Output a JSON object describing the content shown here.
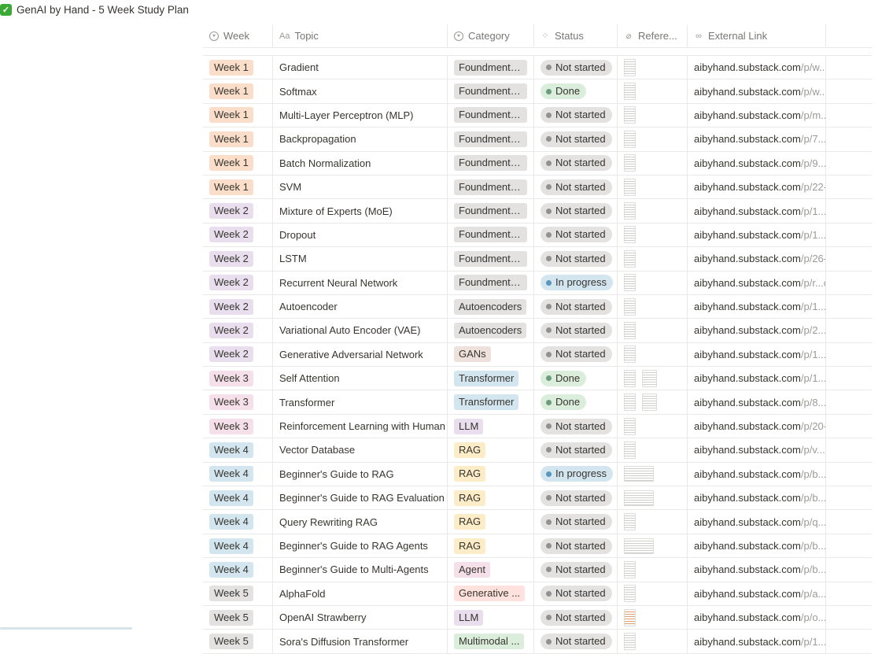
{
  "window": {
    "title": "GenAI by Hand - 5 Week Study Plan"
  },
  "headers": {
    "week": "Week",
    "topic": "Topic",
    "category": "Category",
    "status": "Status",
    "reference": "Refere...",
    "link": "External Link",
    "topic_icon": "Aa"
  },
  "rows": [
    {
      "week": "Week 1",
      "wk": "w1",
      "topic": "Gradient",
      "category": "Foundmentals",
      "cat": "cat-f",
      "status": "Not started",
      "st": "st-ns",
      "link_domain": "aibyhand.substack.com",
      "link_path": "/p/w..."
    },
    {
      "week": "Week 1",
      "wk": "w1",
      "topic": "Softmax",
      "category": "Foundmentals",
      "cat": "cat-f",
      "status": "Done",
      "st": "st-done",
      "link_domain": "aibyhand.substack.com",
      "link_path": "/p/w..."
    },
    {
      "week": "Week 1",
      "wk": "w1",
      "topic": "Multi-Layer Perceptron (MLP)",
      "category": "Foundmentals",
      "cat": "cat-f",
      "status": "Not started",
      "st": "st-ns",
      "link_domain": "aibyhand.substack.com",
      "link_path": "/p/m..."
    },
    {
      "week": "Week 1",
      "wk": "w1",
      "topic": "Backpropagation",
      "category": "Foundmentals",
      "cat": "cat-f",
      "status": "Not started",
      "st": "st-ns",
      "link_domain": "aibyhand.substack.com",
      "link_path": "/p/7..."
    },
    {
      "week": "Week 1",
      "wk": "w1",
      "topic": "Batch Normalization",
      "category": "Foundmentals",
      "cat": "cat-f",
      "status": "Not started",
      "st": "st-ns",
      "link_domain": "aibyhand.substack.com",
      "link_path": "/p/9..."
    },
    {
      "week": "Week 1",
      "wk": "w1",
      "topic": "SVM",
      "category": "Foundmentals",
      "cat": "cat-f",
      "status": "Not started",
      "st": "st-ns",
      "link_domain": "aibyhand.substack.com",
      "link_path": "/p/22-"
    },
    {
      "week": "Week 2",
      "wk": "w2",
      "topic": "Mixture of Experts (MoE)",
      "category": "Foundmentals",
      "cat": "cat-f",
      "status": "Not started",
      "st": "st-ns",
      "link_domain": "aibyhand.substack.com",
      "link_path": "/p/1..."
    },
    {
      "week": "Week 2",
      "wk": "w2",
      "topic": "Dropout",
      "category": "Foundmentals",
      "cat": "cat-f",
      "status": "Not started",
      "st": "st-ns",
      "link_domain": "aibyhand.substack.com",
      "link_path": "/p/1..."
    },
    {
      "week": "Week 2",
      "wk": "w2",
      "topic": "LSTM",
      "category": "Foundmentals",
      "cat": "cat-f",
      "status": "Not started",
      "st": "st-ns",
      "link_domain": "aibyhand.substack.com",
      "link_path": "/p/26-"
    },
    {
      "week": "Week 2",
      "wk": "w2",
      "topic": "Recurrent Neural Network",
      "category": "Foundmentals",
      "cat": "cat-f",
      "status": "In progress",
      "st": "st-ip",
      "link_domain": "aibyhand.substack.com",
      "link_path": "/p/r...c"
    },
    {
      "week": "Week 2",
      "wk": "w2",
      "topic": "Autoencoder",
      "category": "Autoencoders",
      "cat": "cat-a",
      "status": "Not started",
      "st": "st-ns",
      "link_domain": "aibyhand.substack.com",
      "link_path": "/p/1..."
    },
    {
      "week": "Week 2",
      "wk": "w2",
      "topic": "Variational Auto Encoder (VAE)",
      "category": "Autoencoders",
      "cat": "cat-a",
      "status": "Not started",
      "st": "st-ns",
      "link_domain": "aibyhand.substack.com",
      "link_path": "/p/2..."
    },
    {
      "week": "Week 2",
      "wk": "w2",
      "topic": "Generative Adversarial Network",
      "category": "GANs",
      "cat": "cat-g",
      "status": "Not started",
      "st": "st-ns",
      "link_domain": "aibyhand.substack.com",
      "link_path": "/p/1..."
    },
    {
      "week": "Week 3",
      "wk": "w3",
      "topic": "Self Attention",
      "category": "Transformer",
      "cat": "cat-t",
      "status": "Done",
      "st": "st-done",
      "link_domain": "aibyhand.substack.com",
      "link_path": "/p/1...",
      "two": true
    },
    {
      "week": "Week 3",
      "wk": "w3",
      "topic": "Transformer",
      "category": "Transformer",
      "cat": "cat-t",
      "status": "Done",
      "st": "st-done",
      "link_domain": "aibyhand.substack.com",
      "link_path": "/p/8...",
      "two": true
    },
    {
      "week": "Week 3",
      "wk": "w3",
      "topic": "Reinforcement Learning with Human",
      "category": "LLM",
      "cat": "cat-l",
      "status": "Not started",
      "st": "st-ns",
      "link_domain": "aibyhand.substack.com",
      "link_path": "/p/20-"
    },
    {
      "week": "Week 4",
      "wk": "w4",
      "topic": "Vector Database",
      "category": "RAG",
      "cat": "cat-r",
      "status": "Not started",
      "st": "st-ns",
      "link_domain": "aibyhand.substack.com",
      "link_path": "/p/v...c"
    },
    {
      "week": "Week 4",
      "wk": "w4",
      "topic": "Beginner's Guide to RAG",
      "category": "RAG",
      "cat": "cat-r",
      "status": "In progress",
      "st": "st-ip",
      "link_domain": "aibyhand.substack.com",
      "link_path": "/p/b...",
      "wide": true
    },
    {
      "week": "Week 4",
      "wk": "w4",
      "topic": "Beginner's Guide to RAG Evaluation",
      "category": "RAG",
      "cat": "cat-r",
      "status": "Not started",
      "st": "st-ns",
      "link_domain": "aibyhand.substack.com",
      "link_path": "/p/b...",
      "wide": true
    },
    {
      "week": "Week 4",
      "wk": "w4",
      "topic": "Query Rewriting RAG",
      "category": "RAG",
      "cat": "cat-r",
      "status": "Not started",
      "st": "st-ns",
      "link_domain": "aibyhand.substack.com",
      "link_path": "/p/q..."
    },
    {
      "week": "Week 4",
      "wk": "w4",
      "topic": "Beginner's Guide to RAG Agents",
      "category": "RAG",
      "cat": "cat-r",
      "status": "Not started",
      "st": "st-ns",
      "link_domain": "aibyhand.substack.com",
      "link_path": "/p/b...",
      "wide": true
    },
    {
      "week": "Week 4",
      "wk": "w4",
      "topic": "Beginner's Guide to Multi-Agents",
      "category": "Agent",
      "cat": "cat-ag",
      "status": "Not started",
      "st": "st-ns",
      "link_domain": "aibyhand.substack.com",
      "link_path": "/p/b..."
    },
    {
      "week": "Week 5",
      "wk": "w5",
      "topic": "AlphaFold",
      "category": "Generative ...",
      "cat": "cat-ge",
      "status": "Not started",
      "st": "st-ns",
      "link_domain": "aibyhand.substack.com",
      "link_path": "/p/a..."
    },
    {
      "week": "Week 5",
      "wk": "w5",
      "topic": "OpenAI Strawberry",
      "category": "LLM",
      "cat": "cat-l",
      "status": "Not started",
      "st": "st-ns",
      "link_domain": "aibyhand.substack.com",
      "link_path": "/p/o...",
      "color": true
    },
    {
      "week": "Week 5",
      "wk": "w5",
      "topic": "Sora's Diffusion Transformer",
      "category": "Multimodal ...",
      "cat": "cat-m",
      "status": "Not started",
      "st": "st-ns",
      "link_domain": "aibyhand.substack.com",
      "link_path": "/p/1..."
    }
  ],
  "icons": {
    "title": "check-mark-icon",
    "week": "select-icon",
    "category": "select-icon",
    "status": "status-icon",
    "reference": "paperclip-icon",
    "link": "link-icon"
  }
}
